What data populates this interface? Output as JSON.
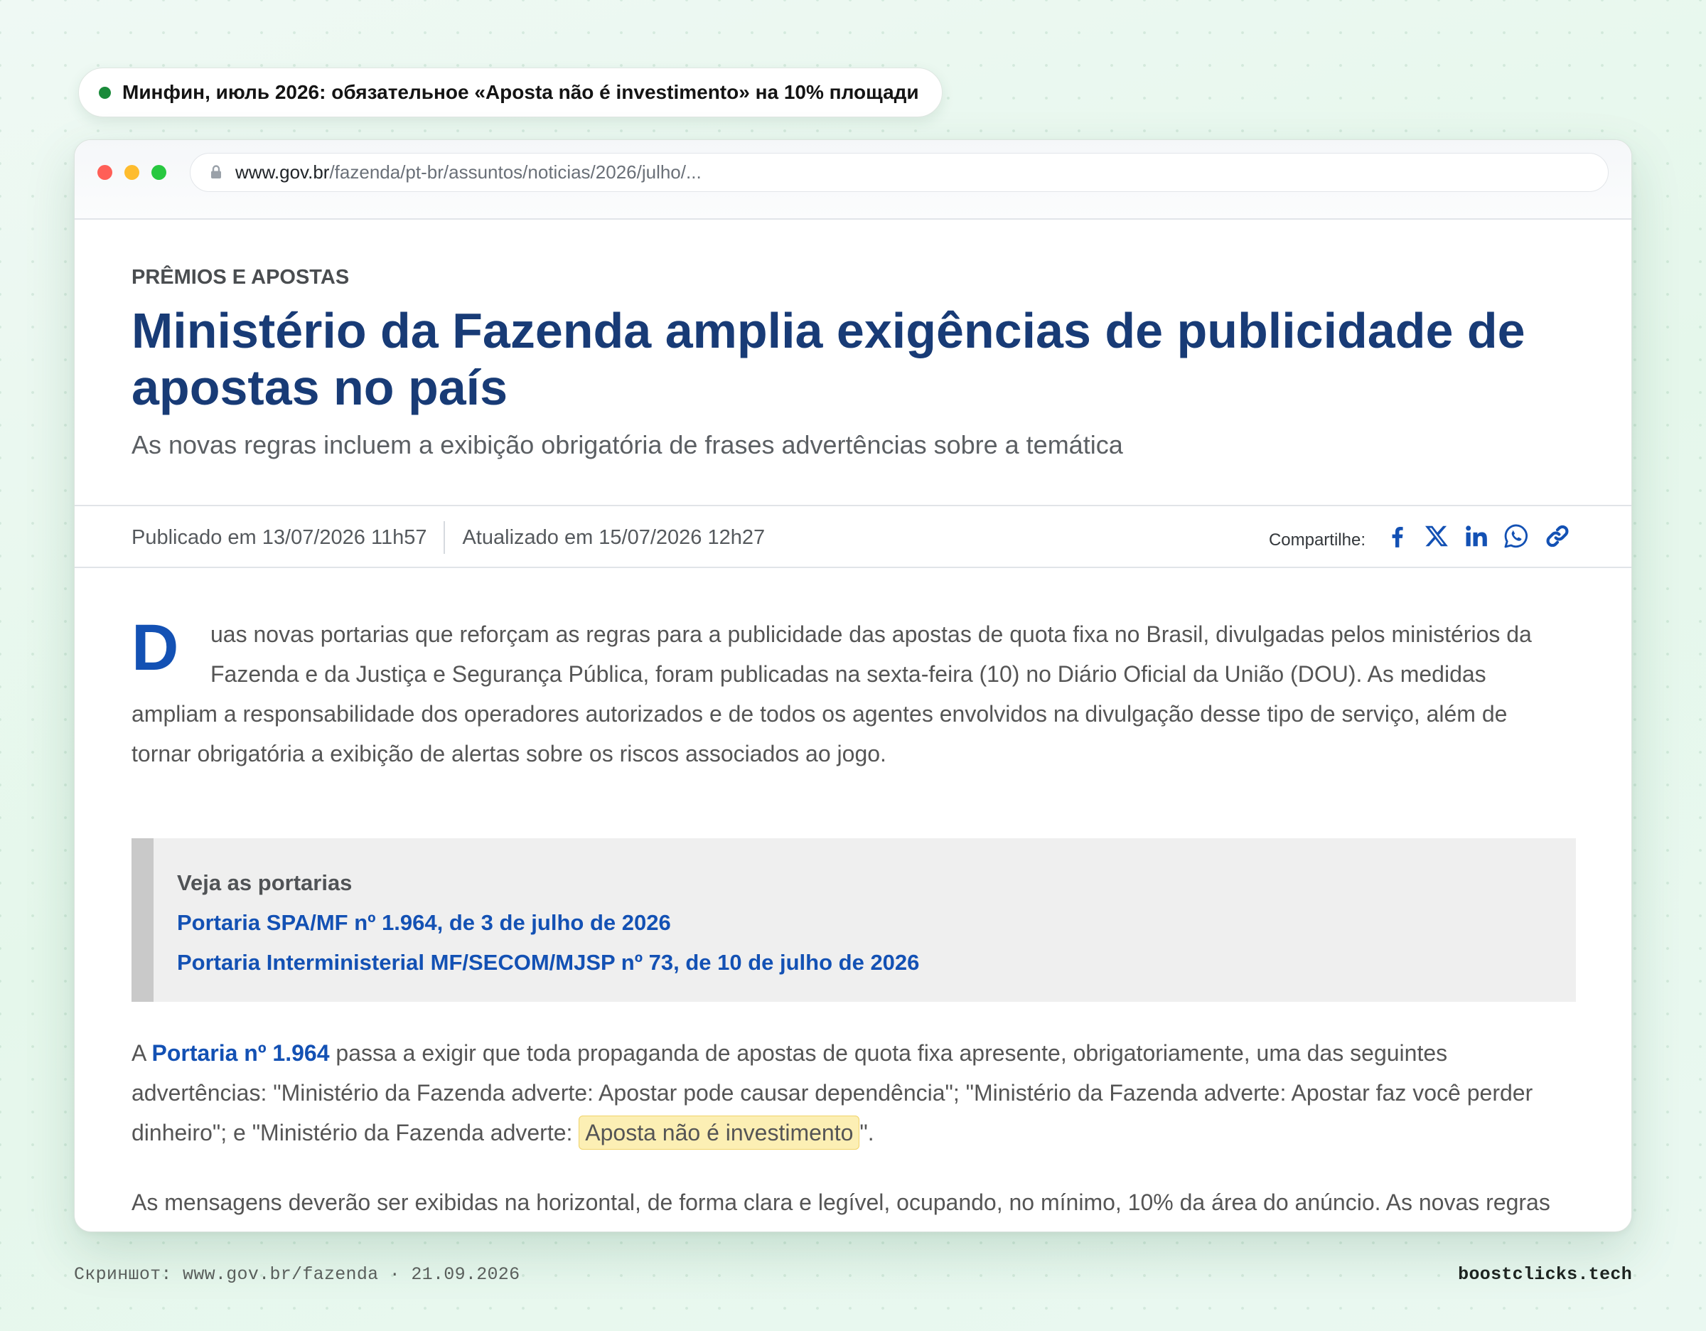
{
  "headline_pill": {
    "text": "Минфин, июль 2026: обязательное «Aposta não é investimento» на 10% площади"
  },
  "browser": {
    "url_domain": "www.gov.br",
    "url_path": "/fazenda/pt-br/assuntos/noticias/2026/julho/..."
  },
  "article": {
    "kicker": "PRÊMIOS E APOSTAS",
    "title": "Ministério da Fazenda amplia exigências de publicidade de apostas no país",
    "subtitle": "As novas regras incluem a exibição obrigatória de frases advertências sobre a temática",
    "published": "Publicado em 13/07/2026 11h57",
    "updated": "Atualizado em 15/07/2026 12h27",
    "share_label": "Compartilhe:",
    "share_icons": [
      "facebook-icon",
      "x-icon",
      "linkedin-icon",
      "whatsapp-icon",
      "link-icon"
    ],
    "lead": {
      "drop_cap": "D",
      "lines": [
        "uas novas portarias que reforçam as regras para a publicidade das apostas de quota fixa no Brasil, divulgadas pelos ministérios da",
        "Fazenda e da Justiça e Segurança Pública, foram publicadas na sexta-feira (10) no Diário Oficial da União (DOU). As medidas",
        "ampliam a responsabilidade dos operadores autorizados e de todos os agentes envolvidos na divulgação desse tipo de serviço, além de",
        "tornar obrigatória a exibição de alertas sobre os riscos associados ao jogo."
      ]
    },
    "portarias_box": {
      "heading": "Veja as portarias",
      "links": [
        "Portaria SPA/MF nº 1.964, de 3 de julho de 2026",
        "Portaria Interministerial MF/SECOM/MJSP nº 73, de 10 de julho de 2026"
      ]
    },
    "paragraph2": {
      "line1_prefix": "A ",
      "line1_link": "Portaria nº 1.964",
      "line1_rest": " passa a exigir que toda propaganda de apostas de quota fixa apresente, obrigatoriamente, uma das seguintes",
      "line2": "advertências: \"Ministério da Fazenda adverte: Apostar pode causar dependência\"; \"Ministério da Fazenda adverte: Apostar faz você perder",
      "line3_prefix": "dinheiro\"; e \"Ministério da Fazenda adverte: ",
      "line3_highlight": "Aposta não é investimento",
      "line3_suffix": "\"."
    },
    "paragraph3": {
      "lines": [
        "As mensagens deverão ser exibidas na horizontal, de forma clara e legível, ocupando, no mínimo, 10% da área do anúncio. As novas regras"
      ]
    }
  },
  "footer": {
    "caption": "Скриншот: www.gov.br/fazenda · 21.09.2026",
    "brand": "boostclicks.tech"
  },
  "colors": {
    "accent_blue": "#1351b4",
    "title_navy": "#183b76",
    "body_gray": "#555555",
    "highlight_bg": "#fcefb4",
    "highlight_border": "#f0d36a",
    "dot_green": "#1a8a3a",
    "close_red": "#ff5f57",
    "minimize_yellow": "#febc2e",
    "maximize_green": "#28c840"
  }
}
